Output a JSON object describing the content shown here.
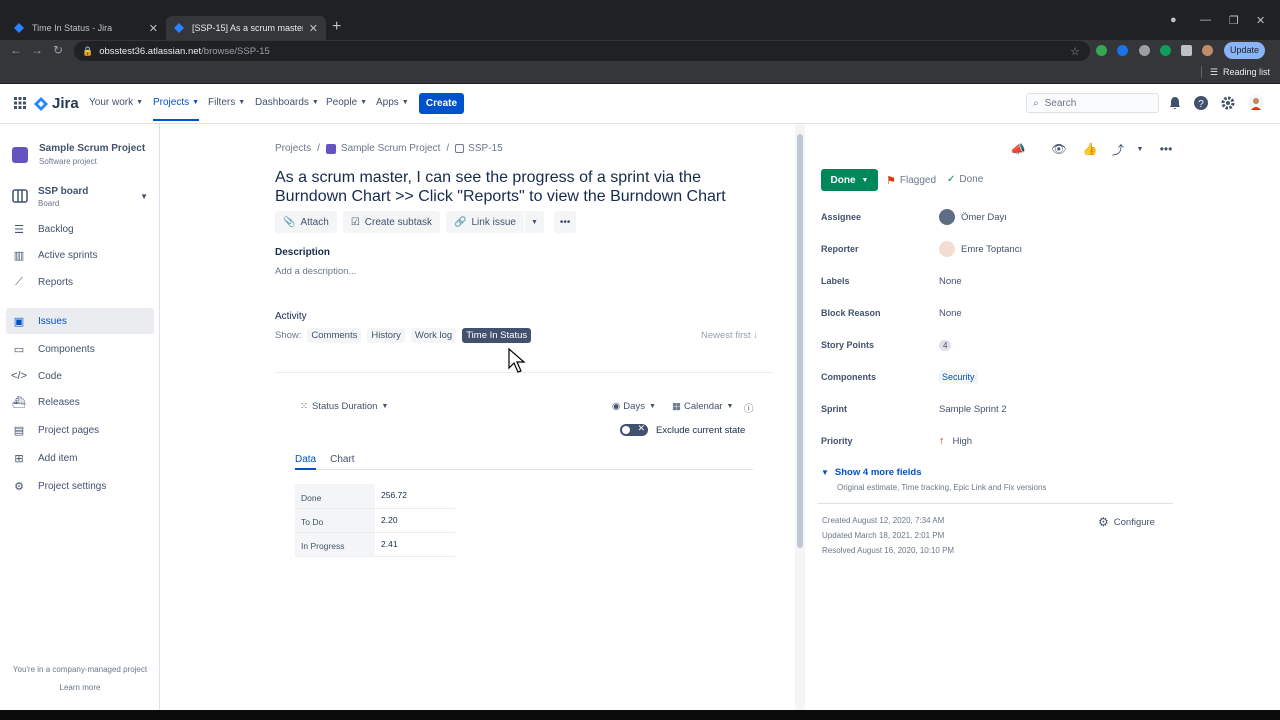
{
  "browser": {
    "tabs": [
      {
        "title": "Time In Status - Jira"
      },
      {
        "title": "[SSP-15] As a scrum master, I can"
      }
    ],
    "url_host": "obsstest36.atlassian.net",
    "url_path": "/browse/SSP-15",
    "update_label": "Update",
    "reading_list": "Reading list"
  },
  "nav": {
    "logo": "Jira",
    "items": [
      "Your work",
      "Projects",
      "Filters",
      "Dashboards",
      "People",
      "Apps"
    ],
    "create": "Create",
    "search_placeholder": "Search"
  },
  "sidebar": {
    "project_name": "Sample Scrum Project",
    "project_type": "Software project",
    "board_name": "SSP board",
    "board_type": "Board",
    "items": [
      "Backlog",
      "Active sprints",
      "Reports",
      "Issues",
      "Components",
      "Code",
      "Releases",
      "Project pages",
      "Add item",
      "Project settings"
    ],
    "footer": "You're in a company-managed project",
    "learn_more": "Learn more"
  },
  "issue": {
    "breadcrumbs": [
      "Projects",
      "Sample Scrum Project",
      "SSP-15"
    ],
    "summary": "As a scrum master, I can see the progress of a sprint via the Burndown Chart >> Click \"Reports\" to view the Burndown Chart",
    "actions": [
      "Attach",
      "Create subtask",
      "Link issue"
    ],
    "description_label": "Description",
    "description_placeholder": "Add a description...",
    "activity_label": "Activity",
    "show_label": "Show:",
    "activity_tabs": [
      "Comments",
      "History",
      "Work log",
      "Time In Status"
    ],
    "sort": "Newest first"
  },
  "time_in_status": {
    "view": "Status Duration",
    "unit": "Days",
    "calendar": "Calendar",
    "exclude_label": "Exclude current state",
    "tabs": [
      "Data",
      "Chart"
    ],
    "rows": [
      {
        "status": "Done",
        "value": "256.72"
      },
      {
        "status": "To Do",
        "value": "2.20"
      },
      {
        "status": "In Progress",
        "value": "2.41"
      }
    ]
  },
  "details": {
    "status": "Done",
    "flagged": "Flagged",
    "resolution": "Done",
    "fields": [
      {
        "label": "Assignee",
        "value": "Ömer Dayı"
      },
      {
        "label": "Reporter",
        "value": "Emre Toptancı"
      },
      {
        "label": "Labels",
        "value": "None"
      },
      {
        "label": "Block Reason",
        "value": "None"
      },
      {
        "label": "Story Points",
        "value": "4"
      },
      {
        "label": "Components",
        "value": "Security"
      },
      {
        "label": "Sprint",
        "value": "Sample Sprint 2"
      },
      {
        "label": "Priority",
        "value": "High"
      }
    ],
    "more_fields": "Show 4 more fields",
    "more_fields_hint": "Original estimate, Time tracking, Epic Link and Fix versions",
    "created": "Created August 12, 2020, 7:34 AM",
    "updated": "Updated March 18, 2021, 2:01 PM",
    "resolved": "Resolved August 16, 2020, 10:10 PM",
    "configure": "Configure"
  },
  "colors": {
    "brand": "#0052cc",
    "done": "#00875a",
    "flag": "#de350b",
    "priority_high": "#de350b"
  }
}
